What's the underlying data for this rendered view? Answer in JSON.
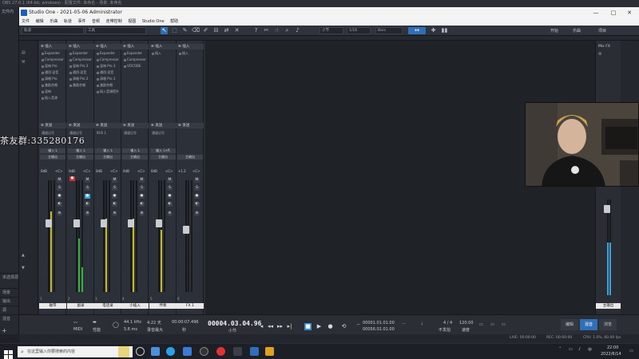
{
  "obs": {
    "title": "OBS 27.0.1 (64-bit, windows) - 配置文件: 未命名 - 场景: 未命名",
    "left_panel_title": "文件内",
    "scene_header": "未选择源",
    "left_items": [
      "场景",
      "输出",
      "源",
      "混音",
      "转场",
      "控制"
    ],
    "status": {
      "live": "LIVE: 00:00:00",
      "rec": "REC: 00:00:00",
      "cpu": "CPU: 1.0%, 60.00 fps"
    }
  },
  "studio_one": {
    "window_title": "Studio One - 2021-05-06 Administrator",
    "menu": [
      "文件",
      "编辑",
      "乐曲",
      "轨道",
      "事件",
      "音频",
      "走带控制",
      "视图",
      "Studio One",
      "帮助"
    ],
    "toolbar": {
      "track_field": "轨道",
      "tool_field": "工具",
      "snap_field": "小节",
      "quantize_field": "1/16",
      "timebase": "Bars",
      "start_label": "开始",
      "song_label": "乐曲",
      "project_label": "项目"
    },
    "channels": [
      {
        "name": "磁带",
        "num": "1",
        "db": "0dB",
        "pan": "<C>",
        "inserts": [
          "Expander",
          "Compressor",
          "混响 Pro",
          "通用·混音",
          "演唱 Pro",
          "激励合唱",
          "混响",
          "插入音源"
        ],
        "sends": [
          "通道记号"
        ],
        "input": "输入 L",
        "output": "主输出",
        "meter_level": 0.72,
        "meter_color": "#c8b820",
        "fader_pos": 0.62
      },
      {
        "name": "副录",
        "num": "2",
        "db": "0dB",
        "pan": "<C>",
        "inserts": [
          "Expander",
          "Compressor",
          "混响 Pro 2",
          "通用·混音",
          "演唱 Pro 2",
          "激励合唱"
        ],
        "sends": [
          "通道记号"
        ],
        "input": "输入 L",
        "output": "主输出",
        "meter_level": 0.48,
        "meter_color": "#3cae3c",
        "fader_pos": 0.62
      },
      {
        "name": "电话录",
        "num": "3",
        "db": "0dB",
        "pan": "<C>",
        "inserts": [
          "Expander",
          "Compressor",
          "混响 Pro 3",
          "通用·混音",
          "演唱 Pro 3",
          "激励合唱",
          "插入音源提升"
        ],
        "sends": [
          "BUS 1"
        ],
        "input": "输入 L",
        "output": "主输出",
        "meter_level": 0.66,
        "meter_color": "#c8b820",
        "fader_pos": 0.62
      },
      {
        "name": "小插入",
        "num": "4",
        "db": "0dB",
        "pan": "<C>",
        "inserts": [
          "Expander",
          "Compressor",
          "VOCODE"
        ],
        "sends": [
          "通道记号"
        ],
        "input": "输入 L",
        "output": "主输出",
        "meter_level": 0.66,
        "meter_color": "#c8b820",
        "fader_pos": 0.62
      },
      {
        "name": "伴奏",
        "num": "5",
        "db": "0dB",
        "pan": "<C>",
        "inserts": [
          "插入"
        ],
        "sends": [
          "通道记号"
        ],
        "input": "输入 L+R",
        "output": "主输出",
        "meter_level": 0.56,
        "meter_color": "#c8b820",
        "fader_pos": 0.62
      },
      {
        "name": "FX 1",
        "num": "6",
        "db": "+1.2",
        "pan": "<C>",
        "inserts": [
          "插入"
        ],
        "sends": [],
        "input": "",
        "output": "主输出",
        "meter_level": 0.0,
        "meter_color": "#3aa0d8",
        "fader_pos": 0.56
      }
    ],
    "mix_fx_label": "Mix FX",
    "main_bus": {
      "label": "Mix FX",
      "name": "主输出",
      "meter_level": 0.55
    },
    "transport": {
      "midi_label": "MIDI",
      "perf_label": "性能",
      "sample_rate": "44.1 kHz",
      "record_time": "4:22 天",
      "latency": "5.6 ms",
      "record_label": "录音最大",
      "sec_time": "00:00:07.496",
      "sec_label": "秒",
      "position": "00004.03.04.96",
      "position_label": "小节",
      "loop_start": "00001.01.01.00",
      "loop_end": "00056.01.01.00",
      "time_sig": "4 / 4",
      "time_sig_label": "不发拍",
      "tempo": "120.00",
      "tempo_label": "速度",
      "tabs": [
        "编辑",
        "混音",
        "浏览"
      ]
    }
  },
  "overlay": {
    "qq_group": "茶友群:335280176"
  },
  "taskbar": {
    "search_placeholder": "在这里输入你要搜索的内容",
    "time": "22:00",
    "date": "2022/6/14"
  },
  "colors": {
    "accent_blue": "#2f6fb8",
    "meter_yellow": "#c8b820",
    "meter_green": "#3cae3c",
    "solo_blue": "#3aa0d8"
  }
}
